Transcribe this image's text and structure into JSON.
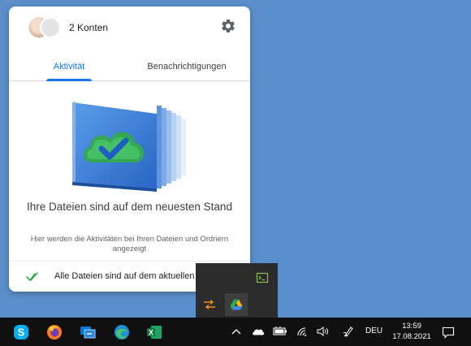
{
  "panel": {
    "accounts_label": "2 Konten",
    "tabs": [
      {
        "label": "Aktivität",
        "active": true
      },
      {
        "label": "Benachrichtigungen",
        "active": false
      }
    ],
    "status_title": "Ihre Dateien sind auf dem neuesten Stand",
    "status_subtitle": "Hier werden die Aktivitäten bei Ihren Dateien und Ordnern angezeigt",
    "footer_text": "Alle Dateien sind auf dem aktuellen Stand",
    "icons": {
      "settings": "gear-icon",
      "footer": "double-check-icon",
      "illustration": "cloud-check-files-illustration"
    }
  },
  "tray_flyout": {
    "icons": [
      "terminal-icon",
      "sync-arrows-icon",
      "google-drive-icon"
    ]
  },
  "taskbar": {
    "apps": [
      "skype-icon",
      "firefox-icon",
      "remote-desktop-icon",
      "edge-icon",
      "excel-icon"
    ],
    "tray_icons": [
      "chevron-up-icon",
      "onedrive-icon",
      "battery-icon",
      "wifi-icon",
      "volume-icon",
      "pen-icon"
    ],
    "language": "DEU",
    "time": "13:59",
    "date": "17.08.2021"
  },
  "colors": {
    "desktop": "#5b8fcb",
    "accent": "#1a73e8",
    "check_green": "#34a853",
    "taskbar": "#101010"
  }
}
